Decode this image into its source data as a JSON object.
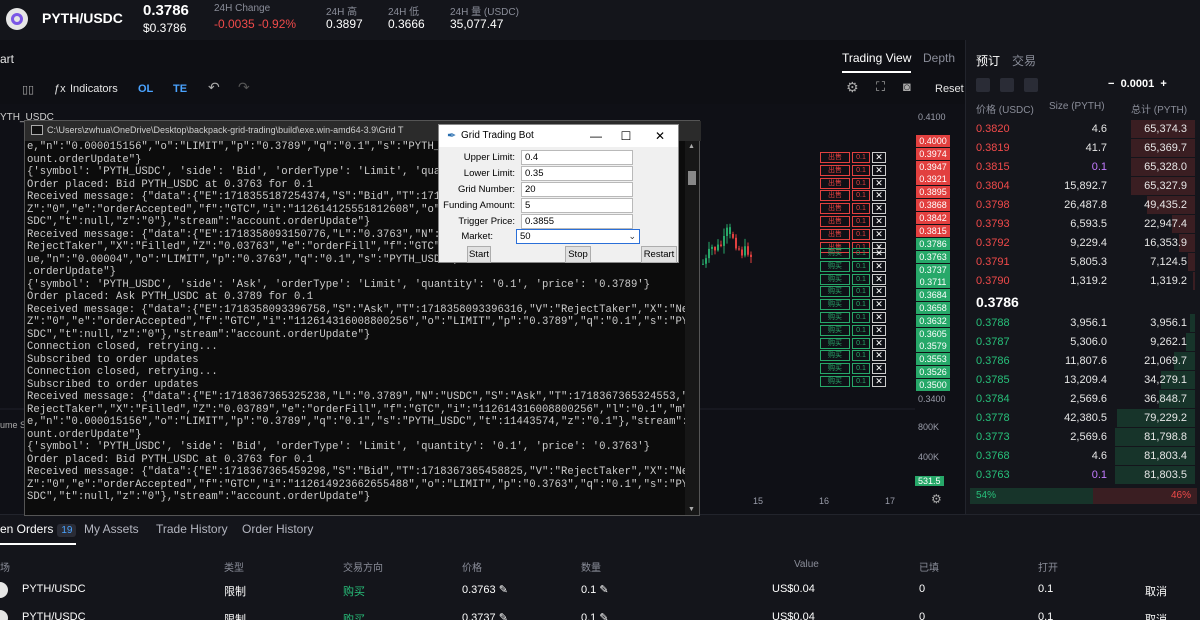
{
  "ticker": {
    "pair": "PYTH/USDC",
    "price": "0.3786",
    "price_usd": "$0.3786",
    "change_label": "24H Change",
    "change_value": "-0.0035 -0.92%",
    "high_label": "24H 高",
    "high_value": "0.3897",
    "low_label": "24H 低",
    "low_value": "0.3666",
    "volume_label": "24H 量 (USDC)",
    "volume_value": "35,077.47"
  },
  "chart_header": {
    "start_label": "art",
    "tabs": [
      "Trading View",
      "Depth"
    ],
    "active_tab": "Trading View"
  },
  "toolbar": {
    "indicators": "Indicators",
    "ol": "OL",
    "te": "TE",
    "reset": "Reset"
  },
  "chart_axis": {
    "top_price": "0.4100",
    "low_price": "0.3400",
    "vol_800k": "800K",
    "vol_400k": "400K",
    "vol_badge": "531.5",
    "x_ticks": [
      "15",
      "16",
      "17"
    ],
    "partial_symbol": "YTH_USDC",
    "partial_volume": "ume S"
  },
  "price_badges_sell": [
    "0.4000",
    "0.3974",
    "0.3947",
    "0.3921",
    "0.3895",
    "0.3868",
    "0.3842",
    "0.3815"
  ],
  "price_badges_buy": [
    "0.3786",
    "0.3763",
    "0.3737",
    "0.3711",
    "0.3684",
    "0.3658",
    "0.3632",
    "0.3605",
    "0.3579",
    "0.3553",
    "0.3526",
    "0.3500"
  ],
  "order_marker": {
    "sell_label": "出售",
    "buy_label": "购买",
    "qty": "0.1",
    "close": "✕"
  },
  "book": {
    "tabs": [
      "预订",
      "交易"
    ],
    "tick_size": "0.0001",
    "headers": [
      "价格 (USDC)",
      "Size (PYTH)",
      "总计 (PYTH)"
    ],
    "asks": [
      {
        "price": "0.3820",
        "size": "4.6",
        "total": "65,374.3",
        "depth": 0.28
      },
      {
        "price": "0.3819",
        "size": "41.7",
        "total": "65,369.7",
        "depth": 0.28
      },
      {
        "price": "0.3815",
        "size": "0.1",
        "total": "65,328.0",
        "depth": 0.28
      },
      {
        "price": "0.3804",
        "size": "15,892.7",
        "total": "65,327.9",
        "depth": 0.28
      },
      {
        "price": "0.3798",
        "size": "26,487.8",
        "total": "49,435.2",
        "depth": 0.21
      },
      {
        "price": "0.3793",
        "size": "6,593.5",
        "total": "22,947.4",
        "depth": 0.1
      },
      {
        "price": "0.3792",
        "size": "9,229.4",
        "total": "16,353.9",
        "depth": 0.07
      },
      {
        "price": "0.3791",
        "size": "5,805.3",
        "total": "7,124.5",
        "depth": 0.03
      },
      {
        "price": "0.3790",
        "size": "1,319.2",
        "total": "1,319.2",
        "depth": 0.01
      }
    ],
    "mid_price": "0.3786",
    "bids": [
      {
        "price": "0.3788",
        "size": "3,956.1",
        "total": "3,956.1",
        "depth": 0.02
      },
      {
        "price": "0.3787",
        "size": "5,306.0",
        "total": "9,262.1",
        "depth": 0.04
      },
      {
        "price": "0.3786",
        "size": "11,807.6",
        "total": "21,069.7",
        "depth": 0.09
      },
      {
        "price": "0.3785",
        "size": "13,209.4",
        "total": "34,279.1",
        "depth": 0.15
      },
      {
        "price": "0.3784",
        "size": "2,569.6",
        "total": "36,848.7",
        "depth": 0.16
      },
      {
        "price": "0.3778",
        "size": "42,380.5",
        "total": "79,229.2",
        "depth": 0.34
      },
      {
        "price": "0.3773",
        "size": "2,569.6",
        "total": "81,798.8",
        "depth": 0.35
      },
      {
        "price": "0.3768",
        "size": "4.6",
        "total": "81,803.4",
        "depth": 0.35
      },
      {
        "price": "0.3763",
        "size": "0.1",
        "total": "81,803.5",
        "depth": 0.35
      }
    ],
    "buy_pct": "54%",
    "sell_pct": "46%",
    "buy_ratio": 0.54
  },
  "bottom": {
    "tabs": [
      "en Orders",
      "My Assets",
      "Trade History",
      "Order History"
    ],
    "open_count": "19",
    "headers": [
      "场",
      "类型",
      "交易方向",
      "价格",
      "数量",
      "Value",
      "已填",
      "打开"
    ],
    "rows": [
      {
        "market": "PYTH/USDC",
        "type": "限制",
        "side": "购买",
        "price": "0.3763",
        "qty": "0.1",
        "value": "US$0.04",
        "filled": "0",
        "open": "0.1",
        "action": "取消"
      },
      {
        "market": "PYTH/USDC",
        "type": "限制",
        "side": "购买",
        "price": "0.3737",
        "qty": "0.1",
        "value": "US$0.04",
        "filled": "0",
        "open": "0.1",
        "action": "取消"
      }
    ]
  },
  "console": {
    "title": "C:\\Users\\zwhua\\OneDrive\\Desktop\\backpack-grid-trading\\build\\exe.win-amd64-3.9\\Grid T",
    "log": "e,\"n\":\"0.000015156\",\"o\":\"LIMIT\",\"p\":\"0.3789\",\"q\":\"0.1\",\"s\":\"PYTH_USDC\"\nount.orderUpdate\"}\n{'symbol': 'PYTH_USDC', 'side': 'Bid', 'orderType': 'Limit', 'quantit\nOrder placed: Bid PYTH_USDC at 0.3763 for 0.1\nReceived message: {\"data\":{\"E\":1718355187254374,\"S\":\"Bid\",\"T\":171835\nZ\":\"0\",\"e\":\"orderAccepted\",\"f\":\"GTC\",\"i\":\"112614125551812608\",\"o\":\"L\nSDC\",\"t\":null,\"z\":\"0\"},\"stream\":\"account.orderUpdate\"}\nReceived message: {\"data\":{\"E\":1718358093150776,\"L\":\"0.3763\",\"N\":\"PY\nRejectTaker\",\"X\":\"Filled\",\"Z\":\"0.03763\",\"e\":\"orderFill\",\"f\":\"GTC\",\"i\nue,\"n\":\"0.00004\",\"o\":\"LIMIT\",\"p\":\"0.3763\",\"q\":\"0.1\",\"s\":\"PYTH_USDC\",\n.orderUpdate\"}\n{'symbol': 'PYTH_USDC', 'side': 'Ask', 'orderType': 'Limit', 'quantity': '0.1', 'price': '0.3789'}\nOrder placed: Ask PYTH_USDC at 0.3789 for 0.1\nReceived message: {\"data\":{\"E\":1718358093396758,\"S\":\"Ask\",\"T\":1718358093396316,\"V\":\"RejectTaker\",\"X\":\"New\",\"\nZ\":\"0\",\"e\":\"orderAccepted\",\"f\":\"GTC\",\"i\":\"112614316008800256\",\"o\":\"LIMIT\",\"p\":\"0.3789\",\"q\":\"0.1\",\"s\":\"PYTH_U\nSDC\",\"t\":null,\"z\":\"0\"},\"stream\":\"account.orderUpdate\"}\nConnection closed, retrying...\nSubscribed to order updates\nConnection closed, retrying...\nSubscribed to order updates\nReceived message: {\"data\":{\"E\":1718367365325238,\"L\":\"0.3789\",\"N\":\"USDC\",\"S\":\"Ask\",\"T\":1718367365324553,\"V\":\"\nRejectTaker\",\"X\":\"Filled\",\"Z\":\"0.03789\",\"e\":\"orderFill\",\"f\":\"GTC\",\"i\":\"112614316008800256\",\"l\":\"0.1\",\"m\":tru\ne,\"n\":\"0.000015156\",\"o\":\"LIMIT\",\"p\":\"0.3789\",\"q\":\"0.1\",\"s\":\"PYTH_USDC\",\"t\":11443574,\"z\":\"0.1\"},\"stream\":\"acc\nount.orderUpdate\"}\n{'symbol': 'PYTH_USDC', 'side': 'Bid', 'orderType': 'Limit', 'quantity': '0.1', 'price': '0.3763'}\nOrder placed: Bid PYTH_USDC at 0.3763 for 0.1\nReceived message: {\"data\":{\"E\":1718367365459298,\"S\":\"Bid\",\"T\":1718367365458825,\"V\":\"RejectTaker\",\"X\":\"New\",\"\nZ\":\"0\",\"e\":\"orderAccepted\",\"f\":\"GTC\",\"i\":\"112614923662655488\",\"o\":\"LIMIT\",\"p\":\"0.3763\",\"q\":\"0.1\",\"s\":\"PYTH_U\nSDC\",\"t\":null,\"z\":\"0\"},\"stream\":\"account.orderUpdate\"}"
  },
  "bot": {
    "title": "Grid Trading Bot",
    "fields": [
      {
        "label": "Upper Limit:",
        "value": "0.4"
      },
      {
        "label": "Lower Limit:",
        "value": "0.35"
      },
      {
        "label": "Grid Number:",
        "value": "20"
      },
      {
        "label": "Funding Amount:",
        "value": "5"
      },
      {
        "label": "Trigger Price:",
        "value": "0.3855"
      }
    ],
    "market_label": "Market:",
    "market_value": "50",
    "start": "Start",
    "stop": "Stop",
    "restart": "Restart",
    "minimize": "—",
    "maximize": "☐",
    "close": "✕"
  }
}
